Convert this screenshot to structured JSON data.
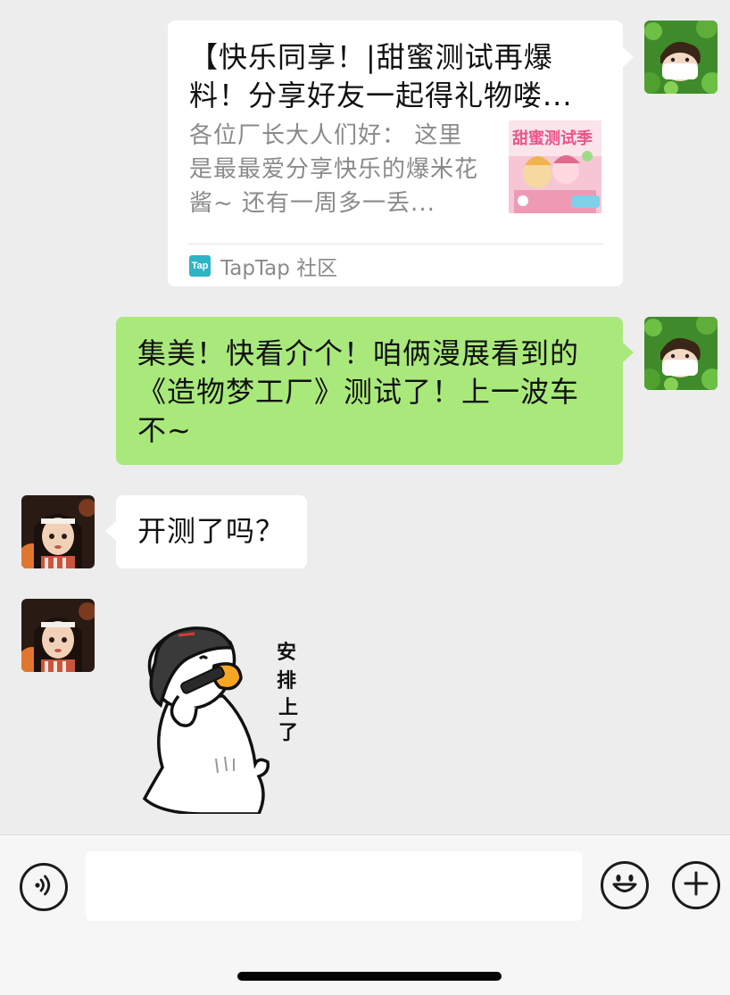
{
  "messages": [
    {
      "sender": "self",
      "type": "link_card",
      "title": "【快乐同享！|甜蜜测试再爆料！分享好友一起得礼物喽...",
      "description": "各位厂长大人们好： 这里是最最爱分享快乐的爆米花酱~ 还有一周多一丢...",
      "thumbnail_text": "甜蜜测试季",
      "source_logo": "Tap",
      "source_name": "TapTap 社区"
    },
    {
      "sender": "self",
      "type": "text",
      "text": "集美！快看介个！咱俩漫展看到的《造物梦工厂》测试了！上一波车不~"
    },
    {
      "sender": "other",
      "type": "text",
      "text": "开测了吗？"
    },
    {
      "sender": "other",
      "type": "sticker",
      "sticker_name": "duck-on-phone-sticker",
      "sticker_text": [
        "安",
        "排",
        "上",
        "了"
      ]
    }
  ],
  "input_bar": {
    "input_value": "",
    "icons": [
      "voice-icon",
      "emoji-icon",
      "plus-icon"
    ]
  },
  "colors": {
    "background": "#ededed",
    "self_bubble": "#a9e97b",
    "other_bubble": "#ffffff",
    "input_bar": "#f6f6f6"
  }
}
